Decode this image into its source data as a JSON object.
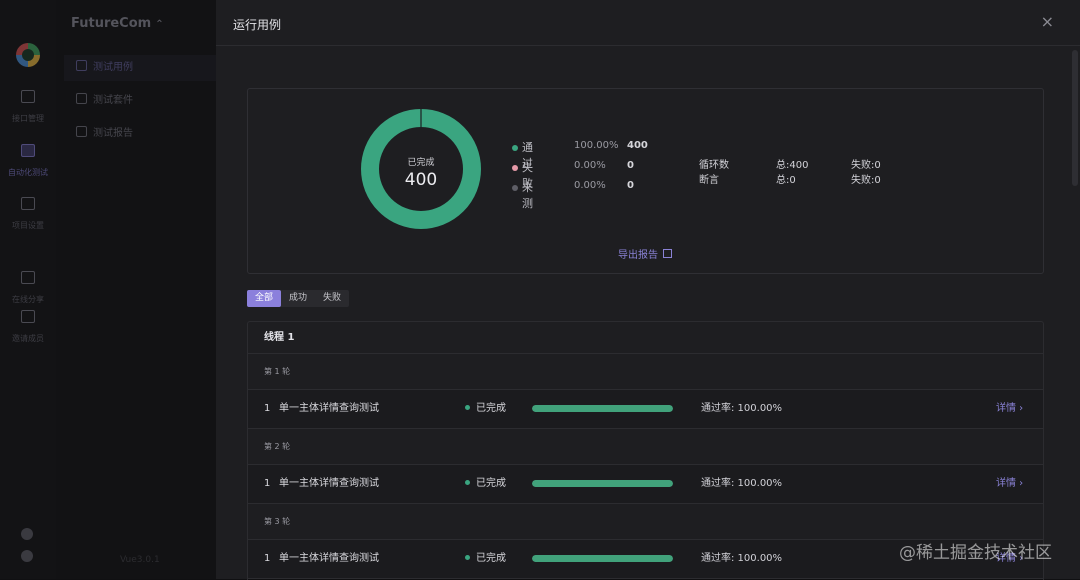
{
  "sidebar": {
    "project": "FutureCom",
    "items": [
      {
        "label": "测试用例",
        "active": true
      },
      {
        "label": "测试套件",
        "active": false
      },
      {
        "label": "测试报告",
        "active": false
      }
    ],
    "footer": "Vue3.0.1"
  },
  "rail": {
    "items": [
      {
        "label": "接口管理",
        "icon": "api-icon"
      },
      {
        "label": "自动化测试",
        "icon": "automation-icon"
      },
      {
        "label": "项目设置",
        "icon": "settings-icon"
      },
      {
        "label": "在线分享",
        "icon": "share-icon"
      },
      {
        "label": "邀请成员",
        "icon": "invite-icon"
      }
    ]
  },
  "drawer": {
    "title": "运行用例",
    "close_icon": "close-icon"
  },
  "summary": {
    "donut_caption": "已完成",
    "total": "400",
    "legend": [
      {
        "name": "通过",
        "pct": "100.00%",
        "count": "400",
        "color": "#3aa580"
      },
      {
        "name": "失败",
        "pct": "0.00%",
        "count": "0",
        "color": "#e69aa8"
      },
      {
        "name": "未测",
        "pct": "0.00%",
        "count": "0",
        "color": "#5e5e66"
      }
    ],
    "stats": [
      {
        "label": "循环数",
        "total": "总:400",
        "failed": "失败:0"
      },
      {
        "label": "断言",
        "total": "总:0",
        "failed": "失败:0"
      }
    ],
    "export_label": "导出报告"
  },
  "filters": [
    {
      "label": "全部",
      "active": true
    },
    {
      "label": "成功",
      "active": false
    },
    {
      "label": "失败",
      "active": false
    }
  ],
  "thread": {
    "title": "线程 1",
    "rounds": [
      {
        "label": "第 1 轮",
        "index": "1",
        "name": "单一主体详情查询测试",
        "status": "已完成",
        "progress": 1.0,
        "rate": "通过率: 100.00%",
        "detail": "详情 ›"
      },
      {
        "label": "第 2 轮",
        "index": "1",
        "name": "单一主体详情查询测试",
        "status": "已完成",
        "progress": 1.0,
        "rate": "通过率: 100.00%",
        "detail": "详情 ›"
      },
      {
        "label": "第 3 轮",
        "index": "1",
        "name": "单一主体详情查询测试",
        "status": "已完成",
        "progress": 1.0,
        "rate": "通过率: 100.00%",
        "detail": "详情 ›"
      }
    ]
  },
  "chart_data": {
    "type": "pie",
    "categories": [
      "通过",
      "失败",
      "未测"
    ],
    "values": [
      400,
      0,
      0
    ]
  },
  "watermark": "@稀土掘金技术社区"
}
